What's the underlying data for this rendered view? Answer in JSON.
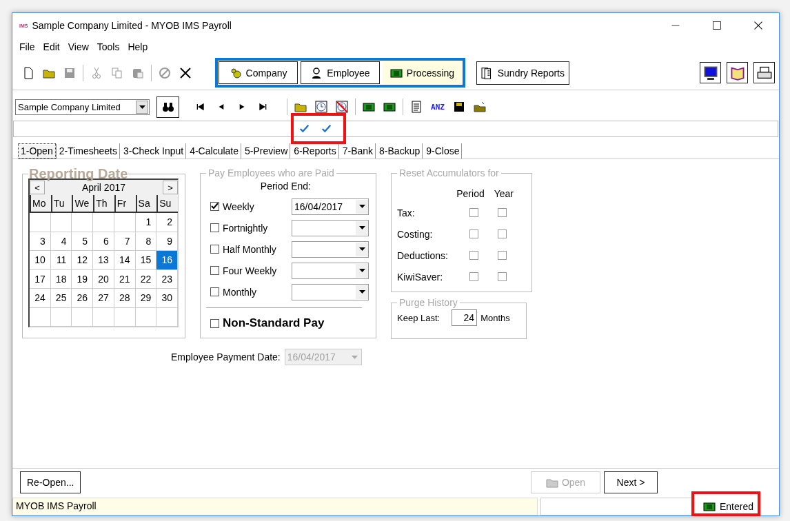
{
  "window": {
    "app_badge": "IMS",
    "title": "Sample Company Limited - MYOB IMS Payroll"
  },
  "menu": [
    "File",
    "Edit",
    "View",
    "Tools",
    "Help"
  ],
  "modules": [
    {
      "label": "Company",
      "kind": "company",
      "selected": false
    },
    {
      "label": "Employee",
      "kind": "employee",
      "selected": false
    },
    {
      "label": "Processing",
      "kind": "processing",
      "selected": true
    }
  ],
  "sundry_reports": "Sundry Reports",
  "company_select": {
    "value": "Sample Company Limited"
  },
  "bank_label": "ANZ",
  "tabs": [
    {
      "label": "1-Open",
      "selected": true
    },
    {
      "label": "2-Timesheets",
      "selected": false
    },
    {
      "label": "3-Check Input",
      "selected": false
    },
    {
      "label": "4-Calculate",
      "selected": false
    },
    {
      "label": "5-Preview",
      "selected": false
    },
    {
      "label": "6-Reports",
      "selected": false
    },
    {
      "label": "7-Bank",
      "selected": false
    },
    {
      "label": "8-Backup",
      "selected": false
    },
    {
      "label": "9-Close",
      "selected": false
    }
  ],
  "reporting_date": {
    "title": "Reporting Date",
    "prev": "<",
    "next": ">",
    "month": "April 2017",
    "weekdays": [
      "Mo",
      "Tu",
      "We",
      "Th",
      "Fr",
      "Sa",
      "Su"
    ],
    "weeks": [
      [
        {
          "d": "1",
          "selected": false
        },
        {
          "d": "2",
          "selected": false
        }
      ],
      [
        {
          "d": "3",
          "selected": false
        },
        {
          "d": "4",
          "selected": false
        },
        {
          "d": "5",
          "selected": false
        },
        {
          "d": "6",
          "selected": false
        },
        {
          "d": "7",
          "selected": false
        },
        {
          "d": "8",
          "selected": false
        },
        {
          "d": "9",
          "selected": false
        }
      ],
      [
        {
          "d": "10",
          "selected": false
        },
        {
          "d": "11",
          "selected": false
        },
        {
          "d": "12",
          "selected": false
        },
        {
          "d": "13",
          "selected": false
        },
        {
          "d": "14",
          "selected": false
        },
        {
          "d": "15",
          "selected": false
        },
        {
          "d": "16",
          "selected": true
        }
      ],
      [
        {
          "d": "17",
          "selected": false
        },
        {
          "d": "18",
          "selected": false
        },
        {
          "d": "19",
          "selected": false
        },
        {
          "d": "20",
          "selected": false
        },
        {
          "d": "21",
          "selected": false
        },
        {
          "d": "22",
          "selected": false
        },
        {
          "d": "23",
          "selected": false
        }
      ],
      [
        {
          "d": "24",
          "selected": false
        },
        {
          "d": "25",
          "selected": false
        },
        {
          "d": "26",
          "selected": false
        },
        {
          "d": "27",
          "selected": false
        },
        {
          "d": "28",
          "selected": false
        },
        {
          "d": "29",
          "selected": false
        },
        {
          "d": "30",
          "selected": false
        }
      ]
    ]
  },
  "pay_group": {
    "title": "Pay Employees who are Paid",
    "period_end_label": "Period End:",
    "rows": [
      {
        "label": "Weekly",
        "checked": true,
        "value": "16/04/2017"
      },
      {
        "label": "Fortnightly",
        "checked": false
      },
      {
        "label": "Half Monthly",
        "checked": false
      },
      {
        "label": "Four Weekly",
        "checked": false
      },
      {
        "label": "Monthly",
        "checked": false
      }
    ],
    "non_standard": {
      "label": "Non-Standard Pay",
      "checked": false
    }
  },
  "employee_payment_date": {
    "label": "Employee Payment Date:",
    "value": "16/04/2017",
    "disabled": true
  },
  "reset": {
    "title": "Reset Accumulators for",
    "columns": [
      "Period",
      "Year"
    ],
    "rows": [
      {
        "label": "Tax:",
        "period": false,
        "year": false
      },
      {
        "label": "Costing:",
        "period": false,
        "year": false
      },
      {
        "label": "Deductions:",
        "period": false,
        "year": false
      },
      {
        "label": "KiwiSaver:",
        "period": false,
        "year": false
      }
    ]
  },
  "purge": {
    "title": "Purge History",
    "label": "Keep Last:",
    "value": "24",
    "unit": "Months"
  },
  "footer": {
    "reopen": "Re-Open...",
    "open": {
      "label": "Open",
      "disabled": true
    },
    "next": "Next >"
  },
  "status_bar": {
    "text": "MYOB IMS Payroll",
    "state": "Entered"
  }
}
